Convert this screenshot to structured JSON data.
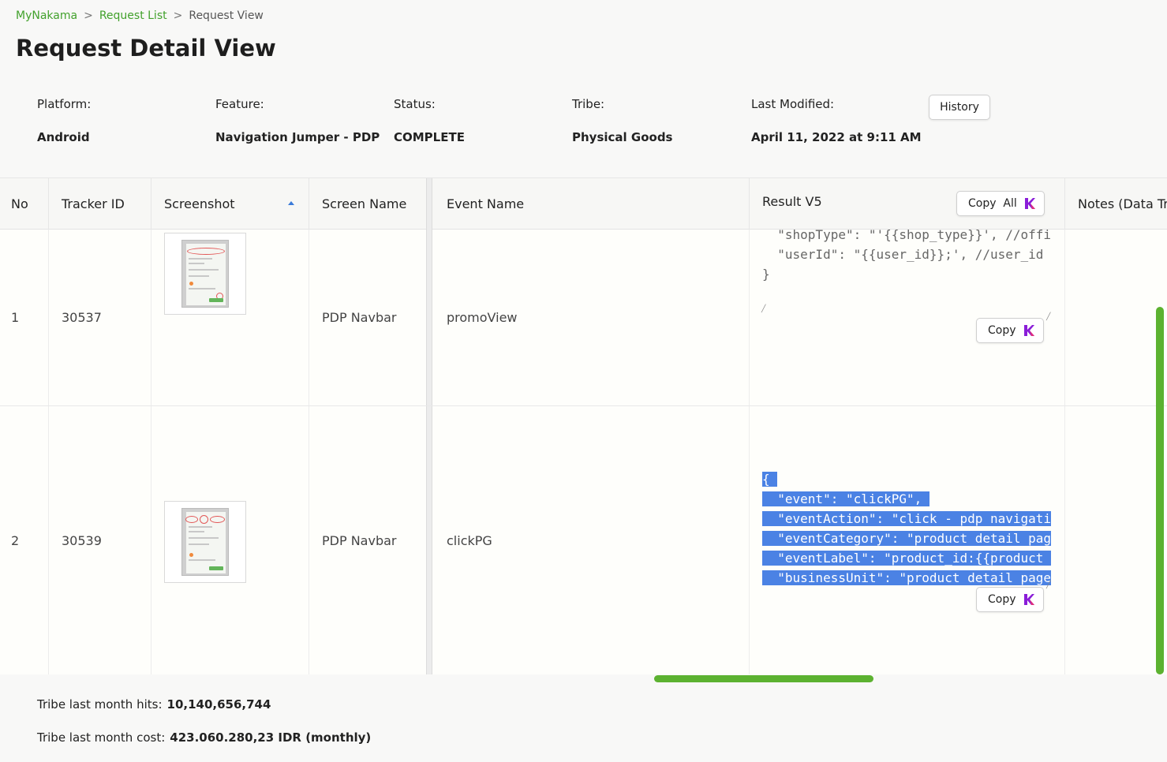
{
  "breadcrumb": {
    "home": "MyNakama",
    "list": "Request List",
    "current": "Request View",
    "sep": ">"
  },
  "page_title": "Request Detail View",
  "meta": {
    "platform_label": "Platform:",
    "platform_value": "Android",
    "feature_label": "Feature:",
    "feature_value": "Navigation Jumper - PDP",
    "status_label": "Status:",
    "status_value": "COMPLETE",
    "tribe_label": "Tribe:",
    "tribe_value": "Physical Goods",
    "modified_label": "Last Modified:",
    "modified_value": "April 11, 2022 at 9:11 AM",
    "history_label": "History"
  },
  "table": {
    "headers": {
      "no": "No",
      "tracker_id": "Tracker ID",
      "screenshot": "Screenshot",
      "screen_name": "Screen Name",
      "event_name": "Event Name",
      "result": "Result V5",
      "notes": "Notes (Data Tra"
    },
    "copy_all_label": "Copy  All",
    "copy_label": "Copy",
    "rows": [
      {
        "no": "1",
        "tracker_id": "30537",
        "screen_name": "PDP Navbar",
        "event_name": "promoView",
        "code": [
          "  \"shopType\": \"'{{shop_type}}', //offi",
          "  \"userId\": \"{{user_id}};', //user_id",
          "}"
        ]
      },
      {
        "no": "2",
        "tracker_id": "30539",
        "screen_name": "PDP Navbar",
        "event_name": "clickPG",
        "code": [
          "{ ",
          "  \"event\": \"clickPG\", ",
          "  \"eventAction\": \"click - pdp navigati",
          "  \"eventCategory\": \"product detail pag",
          "  \"eventLabel\": \"product_id:{{product ",
          "  \"businessUnit\": \"product detail page"
        ]
      }
    ]
  },
  "footer": {
    "hits_label": "Tribe last month hits:",
    "hits_value": "10,140,656,744",
    "cost_label": "Tribe last month cost:",
    "cost_value": "423.060.280,23 IDR (monthly)"
  },
  "colors": {
    "accent_green": "#42a12c",
    "scrollbar_green": "#5cb230",
    "selection_blue": "#4b82e4",
    "k_icon_purple": "#8a1dd8"
  }
}
